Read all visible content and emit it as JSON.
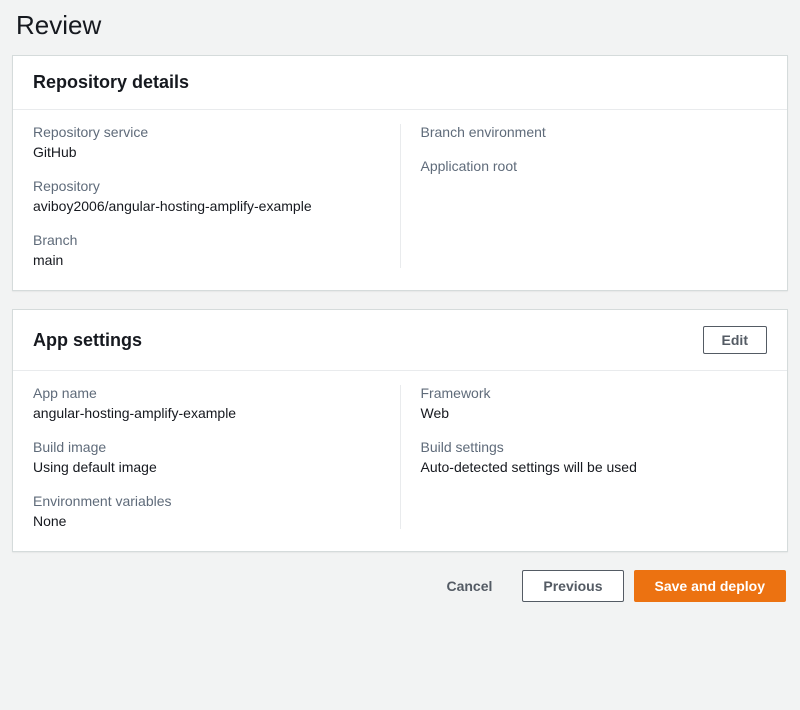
{
  "page_title": "Review",
  "repo_panel": {
    "heading": "Repository details",
    "left": [
      {
        "label": "Repository service",
        "value": "GitHub"
      },
      {
        "label": "Repository",
        "value": "aviboy2006/angular-hosting-amplify-example"
      },
      {
        "label": "Branch",
        "value": "main"
      }
    ],
    "right": [
      {
        "label": "Branch environment",
        "value": ""
      },
      {
        "label": "Application root",
        "value": ""
      }
    ]
  },
  "app_panel": {
    "heading": "App settings",
    "edit_label": "Edit",
    "left": [
      {
        "label": "App name",
        "value": "angular-hosting-amplify-example"
      },
      {
        "label": "Build image",
        "value": "Using default image"
      },
      {
        "label": "Environment variables",
        "value": "None"
      }
    ],
    "right": [
      {
        "label": "Framework",
        "value": "Web"
      },
      {
        "label": "Build settings",
        "value": "Auto-detected settings will be used"
      }
    ]
  },
  "actions": {
    "cancel": "Cancel",
    "previous": "Previous",
    "save_deploy": "Save and deploy"
  }
}
